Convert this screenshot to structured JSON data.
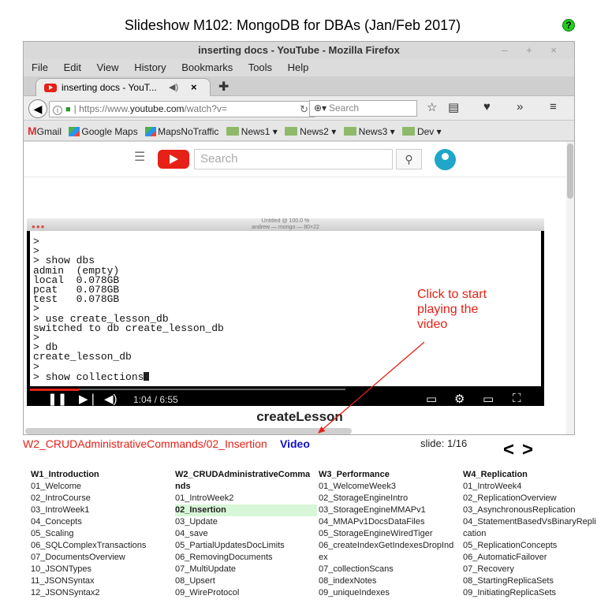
{
  "page": {
    "title": "Slideshow M102: MongoDB for DBAs (Jan/Feb 2017)",
    "help_icon": "?"
  },
  "firefox": {
    "window_title": "inserting docs - YouTube - Mozilla Firefox",
    "window_buttons": "– + ×",
    "menu": [
      "File",
      "Edit",
      "View",
      "History",
      "Bookmarks",
      "Tools",
      "Help"
    ],
    "tab_label": "inserting docs - YouT...",
    "url_prefix": "https://www.",
    "url_host": "youtube.com",
    "url_suffix": "/watch?v=",
    "search_placeholder": "Search",
    "bookmarks": [
      "Gmail",
      "Google Maps",
      "MapsNoTraffic",
      "News1",
      "News2",
      "News3",
      "Dev"
    ]
  },
  "youtube": {
    "search_placeholder": "Search",
    "inner_window_title": "Untitled @ 100.0 %",
    "terminal_title": "andrew — mongo — 80×22",
    "terminal_lines": [
      ">",
      ">",
      "> show dbs",
      "admin  (empty)",
      "local  0.078GB",
      "pcat   0.078GB",
      "test   0.078GB",
      ">",
      "> use create_lesson_db",
      "switched to db create_lesson_db",
      ">",
      "> db",
      "create_lesson_db",
      ">",
      "> show collections"
    ],
    "video_time": "1:04 / 6:55",
    "progress": 0.155
  },
  "caption": "createLesson",
  "play_hint": "Click to start playing the video",
  "lesson_path": "W2_CRUDAdministrativeCommands/02_Insertion",
  "video_link": "Video",
  "slide": "slide: 1/16",
  "nav": {
    "prev": "<",
    "next": ">"
  },
  "weeks": [
    {
      "title": "W1_Introduction",
      "items": [
        "01_Welcome",
        "02_IntroCourse",
        "03_IntroWeek1",
        "04_Concepts",
        "05_Scaling",
        "06_SQLComplexTransactions",
        "07_DocumentsOverview",
        "10_JSONTypes",
        "11_JSONSyntax",
        "12_JSONSyntax2"
      ]
    },
    {
      "title": "W2_CRUDAdministrativeComma\nnds",
      "items": [
        "01_IntroWeek2",
        "02_Insertion",
        "03_Update",
        "04_save",
        "05_PartialUpdatesDocLimits",
        "06_RemovingDocuments",
        "07_MultiUpdate",
        "08_Upsert",
        "09_WireProtocol"
      ],
      "current": 1
    },
    {
      "title": "W3_Performance",
      "items": [
        "01_WelcomeWeek3",
        "02_StorageEngineIntro",
        "03_StorageEngineMMAPv1",
        "04_MMAPv1DocsDataFiles",
        "05_StorageEngineWiredTiger",
        "06_createIndexGetIndexesDropInd\nex",
        "07_collectionScans",
        "08_indexNotes",
        "09_uniqueIndexes"
      ]
    },
    {
      "title": "W4_Replication",
      "items": [
        "01_IntroWeek4",
        "02_ReplicationOverview",
        "03_AsynchronousReplication",
        "04_StatementBasedVsBinaryRepli\ncation",
        "05_ReplicationConcepts",
        "06_AutomaticFailover",
        "07_Recovery",
        "08_StartingReplicaSets",
        "09_InitiatingReplicaSets"
      ]
    }
  ]
}
